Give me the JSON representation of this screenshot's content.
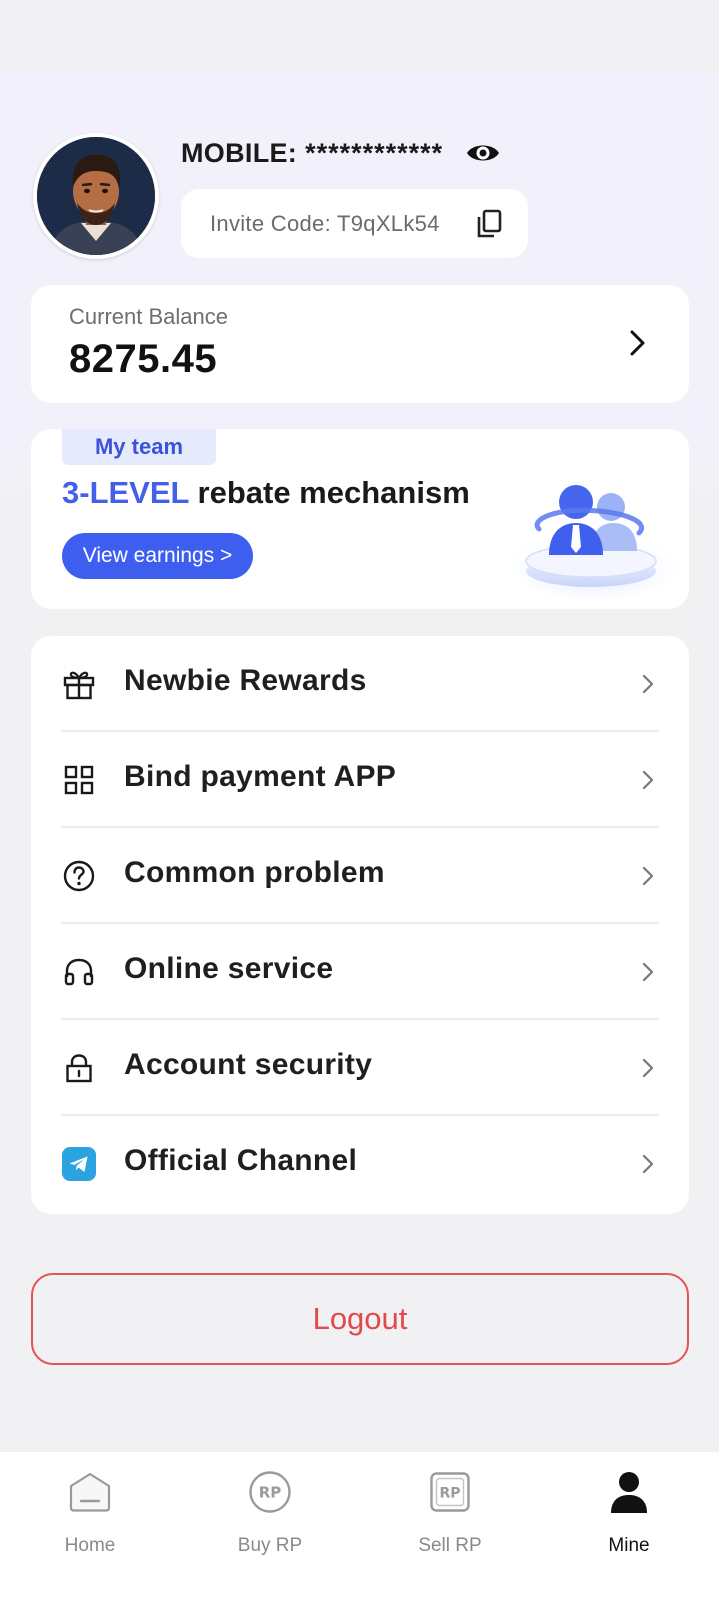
{
  "profile": {
    "mobile_label": "MOBILE:",
    "mobile_value": "************",
    "invite_text": "Invite Code: T9qXLk54"
  },
  "balance": {
    "label": "Current Balance",
    "value": "8275.45"
  },
  "team": {
    "tag": "My team",
    "headline_highlight": "3-LEVEL",
    "headline_rest": " rebate mechanism",
    "button_label": "View earnings >"
  },
  "menu": {
    "items": [
      {
        "label": "Newbie Rewards",
        "icon": "gift-icon"
      },
      {
        "label": "Bind payment APP",
        "icon": "grid-icon"
      },
      {
        "label": "Common problem",
        "icon": "question-icon"
      },
      {
        "label": "Online service",
        "icon": "headset-icon"
      },
      {
        "label": "Account security",
        "icon": "lock-icon"
      },
      {
        "label": "Official Channel",
        "icon": "telegram-icon"
      }
    ]
  },
  "logout_label": "Logout",
  "tabs": [
    {
      "label": "Home",
      "icon": "home-icon"
    },
    {
      "label": "Buy RP",
      "icon": "buy-rp-icon"
    },
    {
      "label": "Sell RP",
      "icon": "sell-rp-icon"
    },
    {
      "label": "Mine",
      "icon": "user-icon",
      "active": true
    }
  ],
  "colors": {
    "accent": "#3e5ef0",
    "logout": "#e04a4a",
    "telegram": "#2aa3e0"
  }
}
